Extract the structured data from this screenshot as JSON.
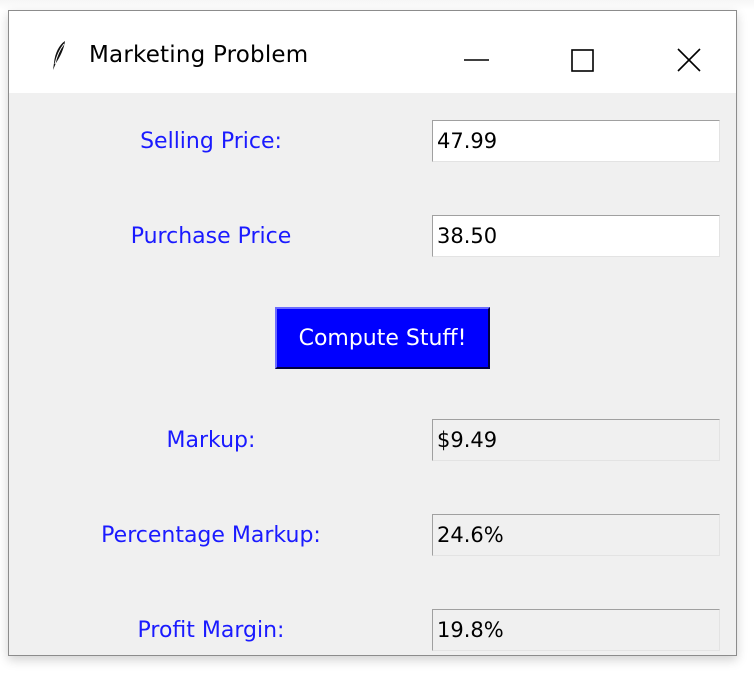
{
  "window": {
    "title": "Marketing Problem",
    "app_icon": "feather-icon",
    "controls": {
      "minimize_icon": "minimize-icon",
      "maximize_icon": "maximize-icon",
      "close_icon": "close-icon"
    }
  },
  "form": {
    "selling_price": {
      "label": "Selling Price:",
      "value": "47.99"
    },
    "purchase_price": {
      "label": "Purchase Price",
      "value": "38.50"
    },
    "compute_button": {
      "label": "Compute Stuff!"
    },
    "markup": {
      "label": "Markup:",
      "value": "$9.49"
    },
    "percentage_markup": {
      "label": "Percentage Markup:",
      "value": "24.6%"
    },
    "profit_margin": {
      "label": "Profit Margin:",
      "value": "19.8%"
    }
  },
  "colors": {
    "label_text": "#1a1aff",
    "button_background": "#0000ff",
    "button_text": "#ffffff",
    "window_background": "#f0f0f0"
  }
}
